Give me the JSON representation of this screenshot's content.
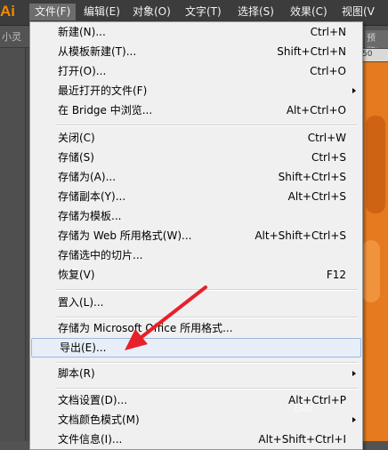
{
  "app": {
    "logo": "Ai"
  },
  "menubar": {
    "items": [
      {
        "label": "文件(F)"
      },
      {
        "label": "编辑(E)"
      },
      {
        "label": "对象(O)"
      },
      {
        "label": "文字(T)"
      },
      {
        "label": "选择(S)"
      },
      {
        "label": "效果(C)"
      },
      {
        "label": "视图(V"
      }
    ]
  },
  "controlbar": {
    "left_text": "小灵",
    "right_text": "预览)"
  },
  "ruler": {
    "tick": "50"
  },
  "file_menu": {
    "items": [
      {
        "label": "新建(N)...",
        "shortcut": "Ctrl+N"
      },
      {
        "label": "从模板新建(T)...",
        "shortcut": "Shift+Ctrl+N"
      },
      {
        "label": "打开(O)...",
        "shortcut": "Ctrl+O"
      },
      {
        "label": "最近打开的文件(F)",
        "shortcut": ""
      },
      {
        "label": "在 Bridge 中浏览...",
        "shortcut": "Alt+Ctrl+O"
      },
      {
        "label": "关闭(C)",
        "shortcut": "Ctrl+W"
      },
      {
        "label": "存储(S)",
        "shortcut": "Ctrl+S"
      },
      {
        "label": "存储为(A)...",
        "shortcut": "Shift+Ctrl+S"
      },
      {
        "label": "存储副本(Y)...",
        "shortcut": "Alt+Ctrl+S"
      },
      {
        "label": "存储为模板...",
        "shortcut": ""
      },
      {
        "label": "存储为 Web 所用格式(W)...",
        "shortcut": "Alt+Shift+Ctrl+S"
      },
      {
        "label": "存储选中的切片...",
        "shortcut": ""
      },
      {
        "label": "恢复(V)",
        "shortcut": "F12"
      },
      {
        "label": "置入(L)...",
        "shortcut": ""
      },
      {
        "label": "存储为 Microsoft Office 所用格式...",
        "shortcut": ""
      },
      {
        "label": "导出(E)...",
        "shortcut": ""
      },
      {
        "label": "脚本(R)",
        "shortcut": ""
      },
      {
        "label": "文档设置(D)...",
        "shortcut": "Alt+Ctrl+P"
      },
      {
        "label": "文档颜色模式(M)",
        "shortcut": ""
      },
      {
        "label": "文件信息(I)...",
        "shortcut": "Alt+Shift+Ctrl+I"
      }
    ]
  },
  "watermark": {
    "text": "Bai"
  },
  "colors": {
    "accent": "#f08a00",
    "arrow": "#e8202a",
    "highlight_border": "#9cb8dd"
  }
}
